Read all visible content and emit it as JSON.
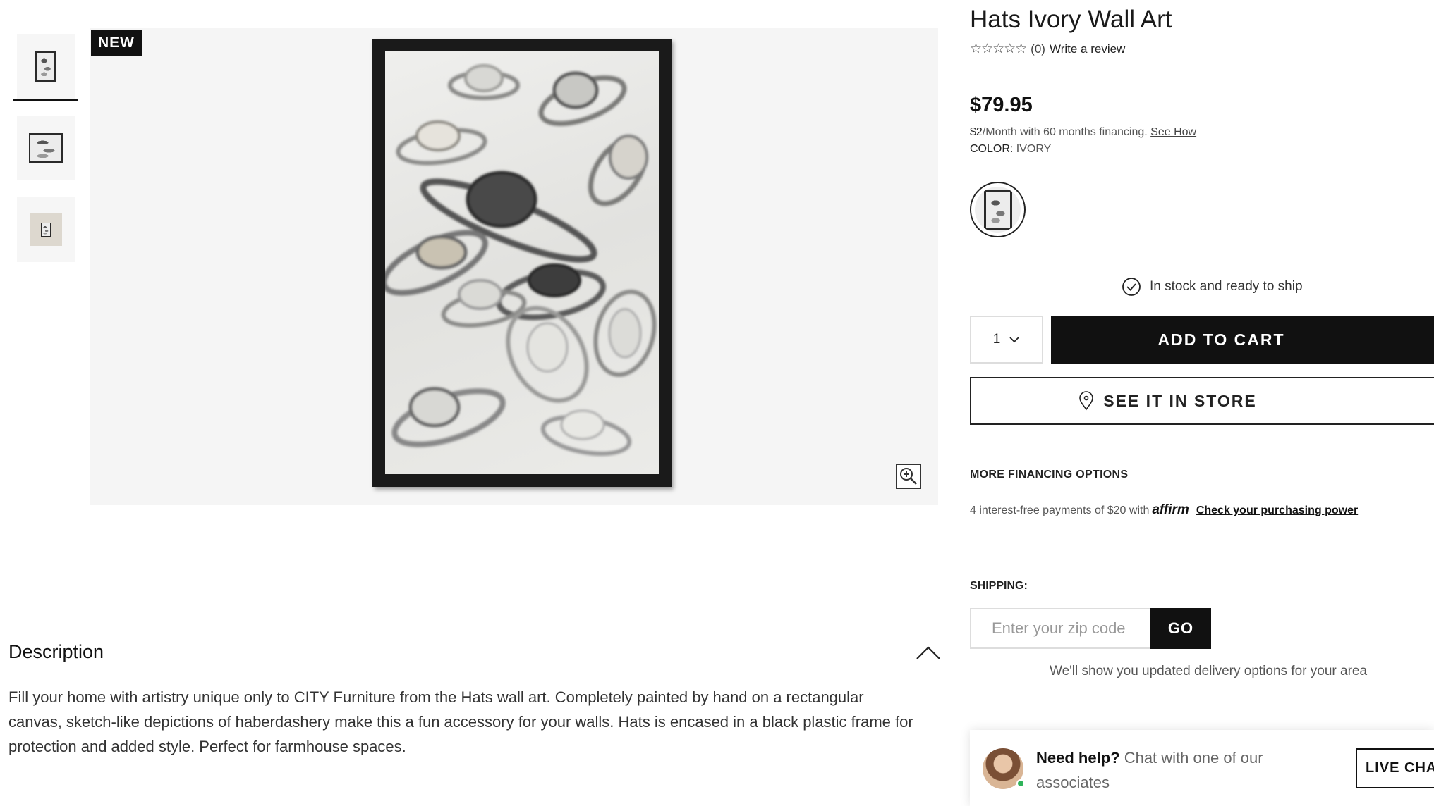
{
  "gallery": {
    "badge": "NEW",
    "thumbnails": [
      "thumbnail-1",
      "thumbnail-2",
      "thumbnail-3"
    ],
    "selected_thumbnail": 1
  },
  "product": {
    "title": "Hats Ivory Wall Art",
    "rating_stars": "☆☆☆☆☆",
    "rating_count": "(0)",
    "write_review": "Write a review",
    "price": "$79.95",
    "financing_amount": "$2",
    "financing_text": "/Month with 60 months financing.",
    "financing_link": "See How",
    "color_label": "COLOR:",
    "color_value": "IVORY",
    "stock_status": "In stock and ready to ship",
    "quantity": "1",
    "add_to_cart": "ADD TO CART",
    "see_in_store": "SEE IT IN STORE"
  },
  "financing": {
    "heading": "MORE FINANCING OPTIONS",
    "text": "4 interest-free payments of $20 with",
    "brand": "affirm",
    "link": "Check your purchasing power"
  },
  "shipping": {
    "label": "SHIPPING:",
    "zip_placeholder": "Enter your zip code",
    "go": "GO",
    "note": "We'll show you updated delivery options for your area"
  },
  "description": {
    "heading": "Description",
    "body": "Fill your home with artistry unique only to CITY Furniture from the Hats wall art. Completely painted by hand on a rectangular canvas, sketch-like depictions of haberdashery make this a fun accessory for your walls. Hats is encased in a black plastic frame for protection and added style. Perfect for farmhouse spaces."
  },
  "chat": {
    "need_help": "Need help?",
    "text": "Chat with one of our associates",
    "button": "LIVE CHAT"
  },
  "colors": {
    "primary": "#111111",
    "background": "#ffffff",
    "image_bg": "#f5f5f5",
    "online": "#2fb35a"
  }
}
